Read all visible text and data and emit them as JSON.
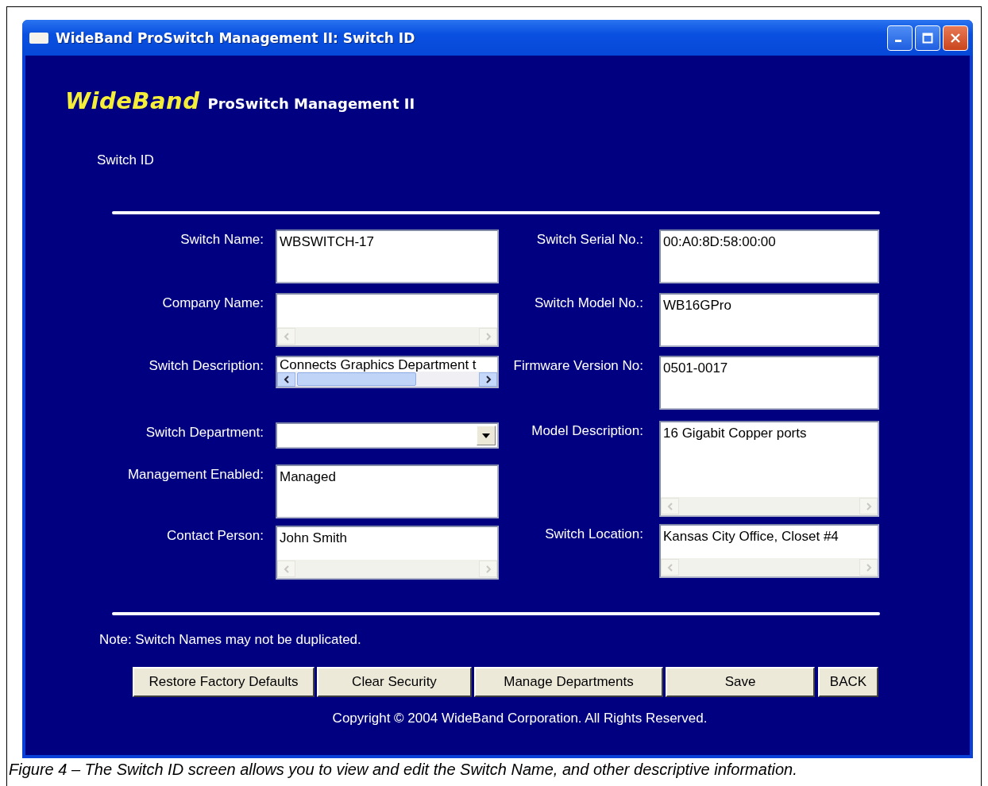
{
  "window": {
    "title": "WideBand ProSwitch Management II: Switch ID"
  },
  "logo": {
    "brand": "WideBand",
    "product": "ProSwitch Management II"
  },
  "section_title": "Switch ID",
  "left_fields": [
    {
      "label": "Switch Name:",
      "kind": "text",
      "value": "WBSWITCH-17"
    },
    {
      "label": "Company Name:",
      "kind": "scroll",
      "scrollbar_enabled": false
    },
    {
      "label": "Switch Description:",
      "kind": "scroll",
      "value": "Connects Graphics Department t",
      "scrollbar_enabled": true
    },
    {
      "label": "Switch Department:",
      "kind": "dropdown"
    },
    {
      "label": "Management Enabled:",
      "kind": "text",
      "value": "Managed"
    },
    {
      "label": "Contact Person:",
      "kind": "scroll",
      "value": "John Smith",
      "scrollbar_enabled": false
    }
  ],
  "right_fields": [
    {
      "label": "Switch Serial No.:",
      "kind": "text",
      "value": "00:A0:8D:58:00:00"
    },
    {
      "label": "Switch Model No.:",
      "kind": "text",
      "value": "WB16GPro"
    },
    {
      "label": "Firmware Version No:",
      "kind": "text",
      "value": "0501-0017"
    },
    {
      "label": "Model Description:",
      "kind": "scroll",
      "value": "16 Gigabit Copper ports",
      "scrollbar_enabled": false
    },
    {
      "label": "Switch Location:",
      "kind": "scroll",
      "value": "Kansas City Office, Closet #4",
      "scrollbar_enabled": false
    }
  ],
  "note": "Note:  Switch Names may not be duplicated.",
  "buttons": [
    "Restore Factory Defaults",
    "Clear Security",
    "Manage Departments",
    "Save",
    "BACK"
  ],
  "copyright": "Copyright © 2004 WideBand Corporation.  All Rights Reserved.",
  "caption": "Figure 4 – The Switch ID screen allows you to view and edit the Switch Name, and other descriptive information."
}
